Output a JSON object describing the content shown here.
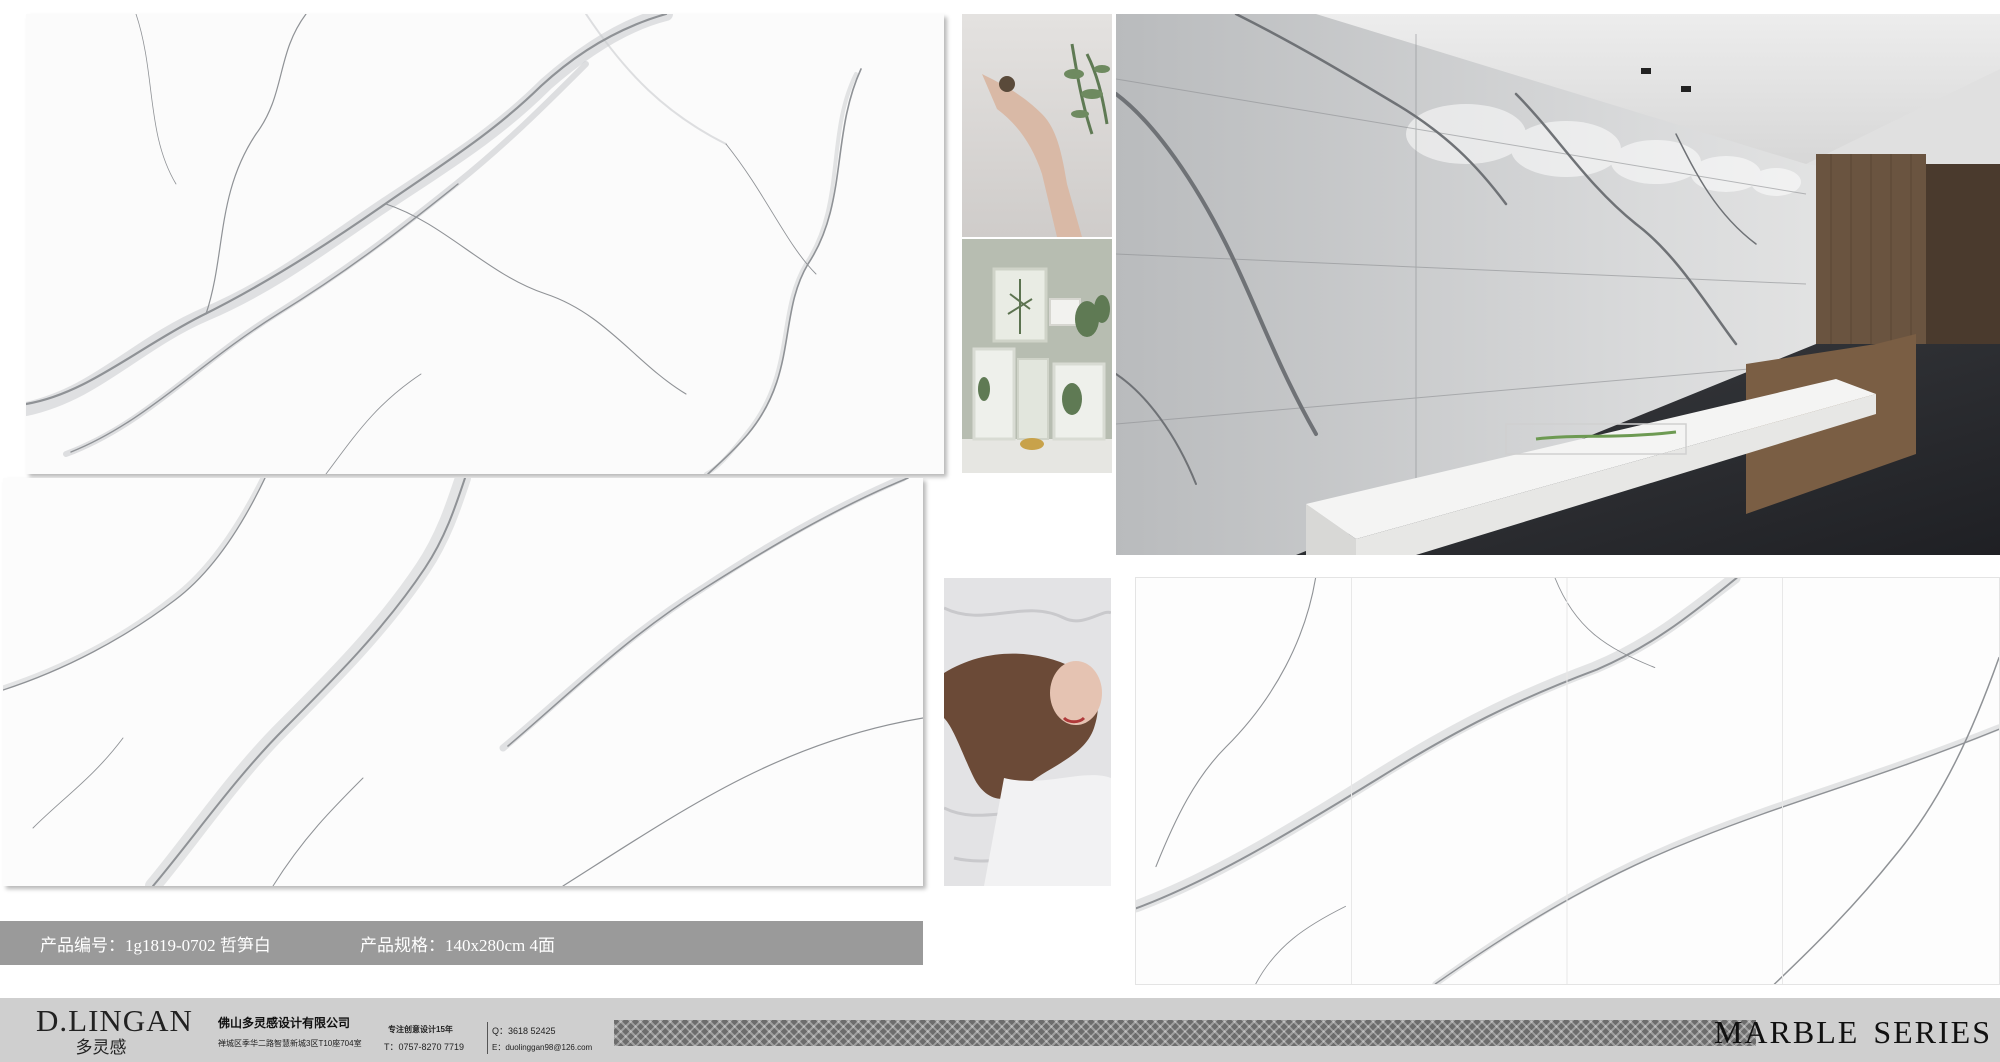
{
  "product": {
    "code_text": "产品编号：1g1819-0702 哲笋白",
    "spec_text": "产品规格：140x280cm 4面"
  },
  "footer": {
    "brand_name": "D.LINGAN",
    "brand_cn": "多灵感",
    "company_name": "佛山多灵感设计有限公司",
    "address": "禅城区季华二路智慧新城3区T10座704室",
    "slogan": "专注创意设计15年",
    "phone": "T：0757-8270 7719",
    "qq": "Q：3618 52425",
    "email": "E：duolinggan98@126.com",
    "series_word1": "MARBLE",
    "series_word2": "SERIES"
  },
  "colors": {
    "vein_dark": "#8f9296",
    "vein_light": "#c9cbce",
    "bar_gray": "#9a9a9a",
    "footer_gray": "#cfcfcf"
  }
}
